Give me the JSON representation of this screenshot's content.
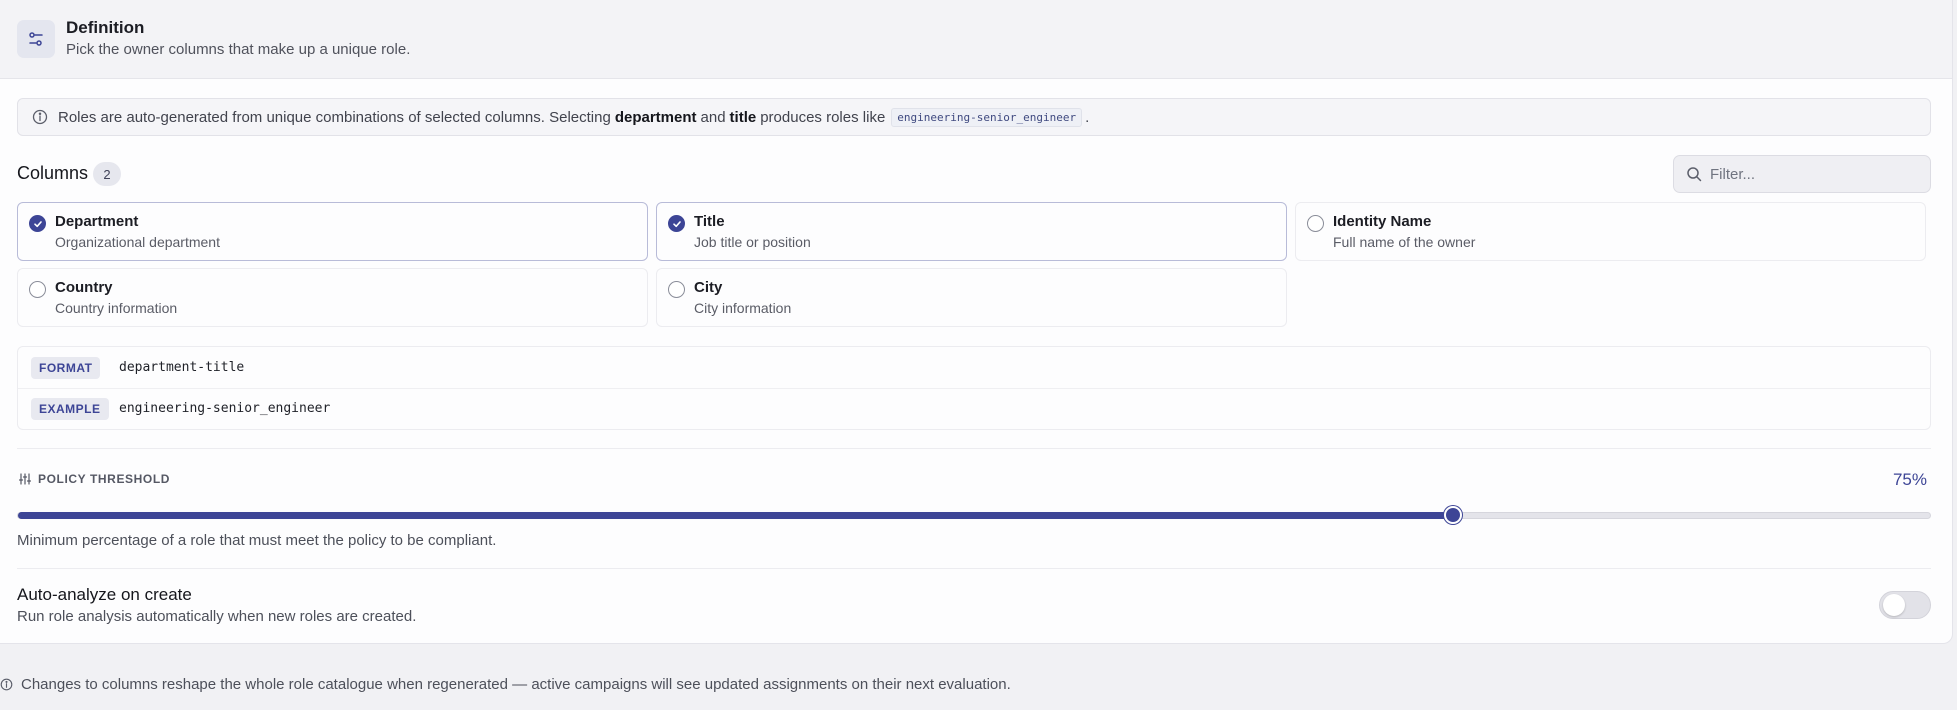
{
  "header": {
    "icon": "sliders-icon",
    "title": "Definition",
    "subtitle": "Pick the owner columns that make up a unique role."
  },
  "info": {
    "icon": "info-icon",
    "text_1": "Roles are auto-generated from unique combinations of selected columns. Selecting",
    "bold_1": "department",
    "text_2": "and",
    "bold_2": "title",
    "text_3": "produces roles like",
    "code": "engineering-senior_engineer",
    "text_4": "."
  },
  "columns": {
    "title": "Columns",
    "count": "2",
    "filter_placeholder": "Filter...",
    "items": [
      {
        "name": "Department",
        "desc": "Organizational department",
        "selected": true
      },
      {
        "name": "Title",
        "desc": "Job title or position",
        "selected": true
      },
      {
        "name": "Identity Name",
        "desc": "Full name of the owner",
        "selected": false
      },
      {
        "name": "Country",
        "desc": "Country information",
        "selected": false
      },
      {
        "name": "City",
        "desc": "City information",
        "selected": false
      }
    ]
  },
  "format": {
    "format_label": "FORMAT",
    "format_value": "department-title",
    "example_label": "EXAMPLE",
    "example_value": "engineering-senior_engineer"
  },
  "policy": {
    "label": "POLICY THRESHOLD",
    "value_text": "75%",
    "value_fraction": 0.75,
    "help": "Minimum percentage of a role that must meet the policy to be compliant."
  },
  "auto_analyze": {
    "title": "Auto-analyze on create",
    "subtitle": "Run role analysis automatically when new roles are created.",
    "enabled": false
  },
  "footer": {
    "note": "Changes to columns reshape the whole role catalogue when regenerated — active campaigns will see updated assignments on their next evaluation."
  },
  "colors": {
    "accent": "#3d4596",
    "background": "#f1f1f4",
    "card": "#fdfdfe"
  }
}
